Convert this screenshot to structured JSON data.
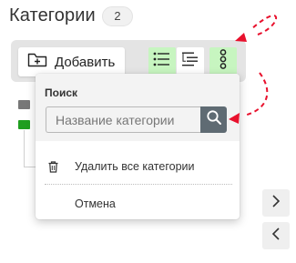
{
  "header": {
    "title": "Категории",
    "count": "2"
  },
  "toolbar": {
    "add_label": "Добавить",
    "add_icon": "folder-plus-icon",
    "tools": [
      {
        "name": "list-view-icon",
        "active": true
      },
      {
        "name": "tree-view-icon",
        "active": false
      },
      {
        "name": "more-vertical-icon",
        "active": true
      }
    ]
  },
  "tree": {
    "folder_colors": [
      "#777777",
      "#1f9e1f"
    ]
  },
  "popup": {
    "search_label": "Поиск",
    "search_placeholder": "Название категории",
    "search_icon": "search-icon",
    "items": [
      {
        "label": "Удалить все категории",
        "icon": "trash-icon"
      },
      {
        "label": "Отмена",
        "icon": ""
      }
    ]
  },
  "side_buttons": [
    {
      "icon": "chevron-right-icon"
    },
    {
      "icon": "chevron-left-icon"
    }
  ],
  "colors": {
    "active_tool": "#c7f5c0",
    "annotation": "#e8112d",
    "search_button": "#5f6b73"
  }
}
